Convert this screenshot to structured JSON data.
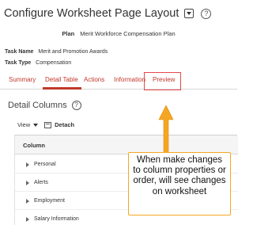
{
  "page": {
    "title": "Configure Worksheet Page Layout",
    "help_glyph": "?"
  },
  "plan": {
    "label": "Plan",
    "value": "Merit Workforce Compensation Plan"
  },
  "task": {
    "name_label": "Task Name",
    "name_value": "Merit and Promotion Awards",
    "type_label": "Task Type",
    "type_value": "Compensation"
  },
  "tabs": [
    {
      "label": "Summary"
    },
    {
      "label": "Detail Table"
    },
    {
      "label": "Actions"
    },
    {
      "label": "Information"
    },
    {
      "label": "Preview"
    }
  ],
  "detail_columns": {
    "title": "Detail Columns",
    "help_glyph": "?"
  },
  "toolbar": {
    "view_label": "View",
    "detach_label": "Detach"
  },
  "table": {
    "column_header": "Column",
    "rows": [
      {
        "label": "Personal"
      },
      {
        "label": "Alerts"
      },
      {
        "label": "Employment"
      },
      {
        "label": "Salary Information"
      }
    ]
  },
  "callout": {
    "text": "When make changes to column properties or order, will see changes on worksheet"
  },
  "colors": {
    "tab_active": "#c0392b",
    "highlight_box": "#e8474c",
    "callout_border": "#f5a623",
    "arrow_fill": "#f5a623"
  }
}
